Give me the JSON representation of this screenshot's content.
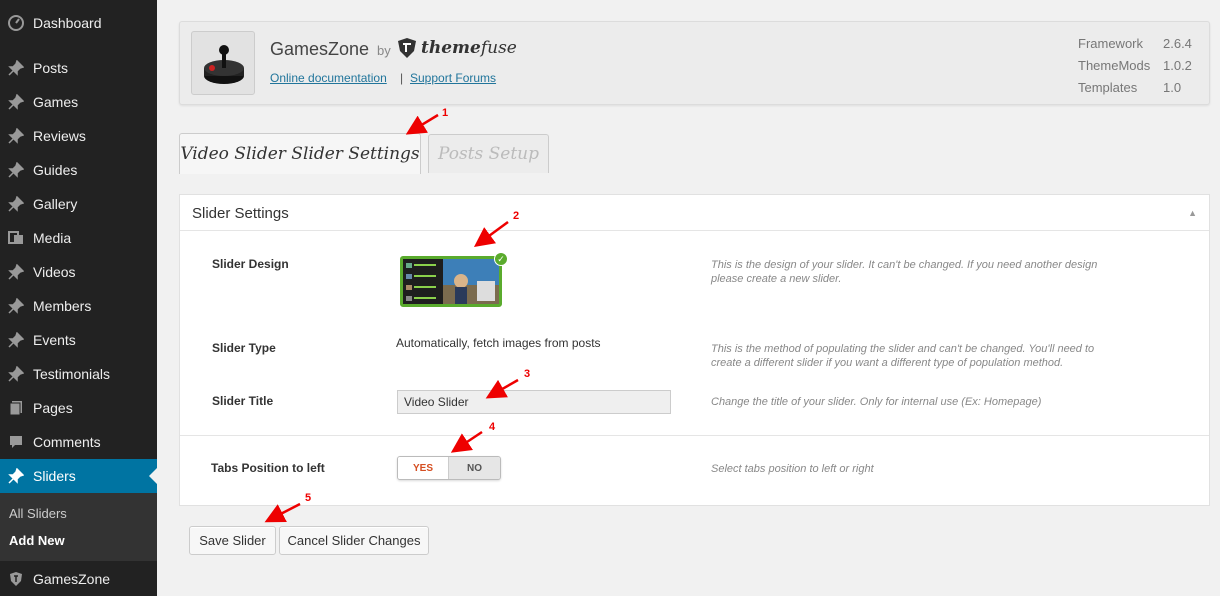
{
  "sidebar": {
    "items": [
      {
        "label": "Dashboard",
        "icon": "dashboard-icon"
      },
      {
        "label": "Posts",
        "icon": "pin-icon"
      },
      {
        "label": "Games",
        "icon": "pin-icon"
      },
      {
        "label": "Reviews",
        "icon": "pin-icon"
      },
      {
        "label": "Guides",
        "icon": "pin-icon"
      },
      {
        "label": "Gallery",
        "icon": "pin-icon"
      },
      {
        "label": "Media",
        "icon": "media-icon"
      },
      {
        "label": "Videos",
        "icon": "pin-icon"
      },
      {
        "label": "Members",
        "icon": "pin-icon"
      },
      {
        "label": "Events",
        "icon": "pin-icon"
      },
      {
        "label": "Testimonials",
        "icon": "pin-icon"
      },
      {
        "label": "Pages",
        "icon": "pages-icon"
      },
      {
        "label": "Comments",
        "icon": "comment-icon"
      },
      {
        "label": "Sliders",
        "icon": "pin-icon"
      }
    ],
    "submenu": [
      "All Sliders",
      "Add New"
    ],
    "bottom_item": {
      "label": "GamesZone",
      "icon": "shield-icon"
    }
  },
  "header": {
    "theme_name": "GamesZone",
    "by": "by",
    "vendor_prefix": "theme",
    "vendor_suffix": "fuse",
    "doc_link": "Online documentation",
    "separator": "|",
    "forum_link": "Support Forums",
    "versions": [
      {
        "label": "Framework",
        "value": "2.6.4"
      },
      {
        "label": "ThemeMods",
        "value": "1.0.2"
      },
      {
        "label": "Templates",
        "value": "1.0"
      }
    ]
  },
  "tabs": [
    "Video Slider Slider Settings",
    "Posts Setup"
  ],
  "panel": {
    "title": "Slider Settings",
    "fields": {
      "design": {
        "label": "Slider Design",
        "desc": "This is the design of your slider. It can't be changed. If you need another design please create a new slider."
      },
      "type": {
        "label": "Slider Type",
        "value": "Automatically, fetch images from posts",
        "desc": "This is the method of populating the slider and can't be changed. You'll need to create a different slider if you want a different type of population method."
      },
      "title": {
        "label": "Slider Title",
        "value": "Video Slider",
        "desc": "Change the title of your slider. Only for internal use (Ex: Homepage)"
      },
      "tabs_position": {
        "label": "Tabs Position to left",
        "yes": "YES",
        "no": "NO",
        "desc": "Select tabs position to left or right"
      }
    }
  },
  "buttons": {
    "save": "Save Slider",
    "cancel": "Cancel Slider Changes"
  },
  "annotations": [
    "1",
    "2",
    "3",
    "4",
    "5"
  ],
  "colors": {
    "sidebar_bg": "#222222",
    "active_bg": "#0074a2",
    "link": "#21759b",
    "selected_green": "#5aab2d",
    "annotation_red": "#ee0000"
  }
}
